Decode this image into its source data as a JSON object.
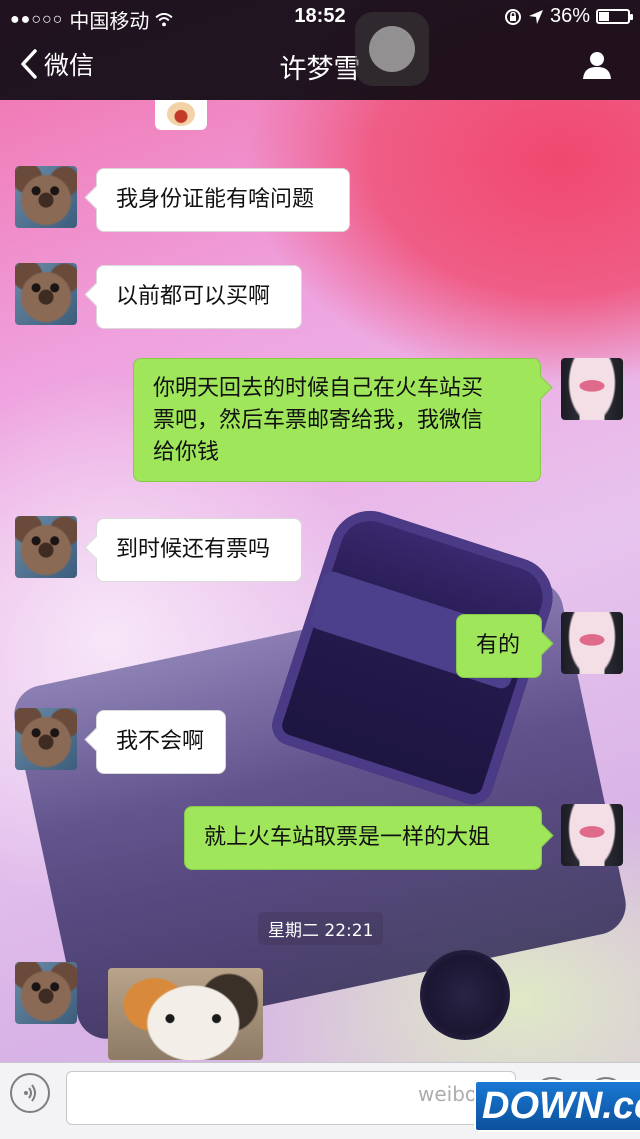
{
  "status_bar": {
    "signal_dots": "●●○○○",
    "carrier": "中国移动",
    "time": "18:52",
    "battery_percent": "36%",
    "battery_level": 0.36
  },
  "nav": {
    "back_label": "微信",
    "title": "许梦雪"
  },
  "messages": [
    {
      "side": "left",
      "text": "我身份证能有啥问题"
    },
    {
      "side": "left",
      "text": "以前都可以买啊"
    },
    {
      "side": "right",
      "lines": [
        "你明天回去的时候自己在火车站买",
        "票吧，然后车票邮寄给我，我微信",
        "给你钱"
      ]
    },
    {
      "side": "left",
      "text": "到时候还有票吗"
    },
    {
      "side": "right",
      "text": "有的"
    },
    {
      "side": "left",
      "text": "我不会啊"
    },
    {
      "side": "right",
      "text": "就上火车站取票是一样的大姐"
    }
  ],
  "timestamp": "星期二 22:21",
  "watermarks": {
    "weibo": "weibo.c",
    "down": "DOWN.cc"
  },
  "colors": {
    "green_bubble": "#9fe65a",
    "white_bubble": "#ffffff",
    "nav_bar": "#100c14"
  },
  "icons": {
    "back": "chevron-left-icon",
    "user": "user-icon",
    "voice": "voice-icon",
    "emoji": "emoji-icon",
    "plus": "plus-icon",
    "wifi": "wifi-icon",
    "location": "location-arrow-icon",
    "lock_rotation": "rotation-lock-icon"
  }
}
